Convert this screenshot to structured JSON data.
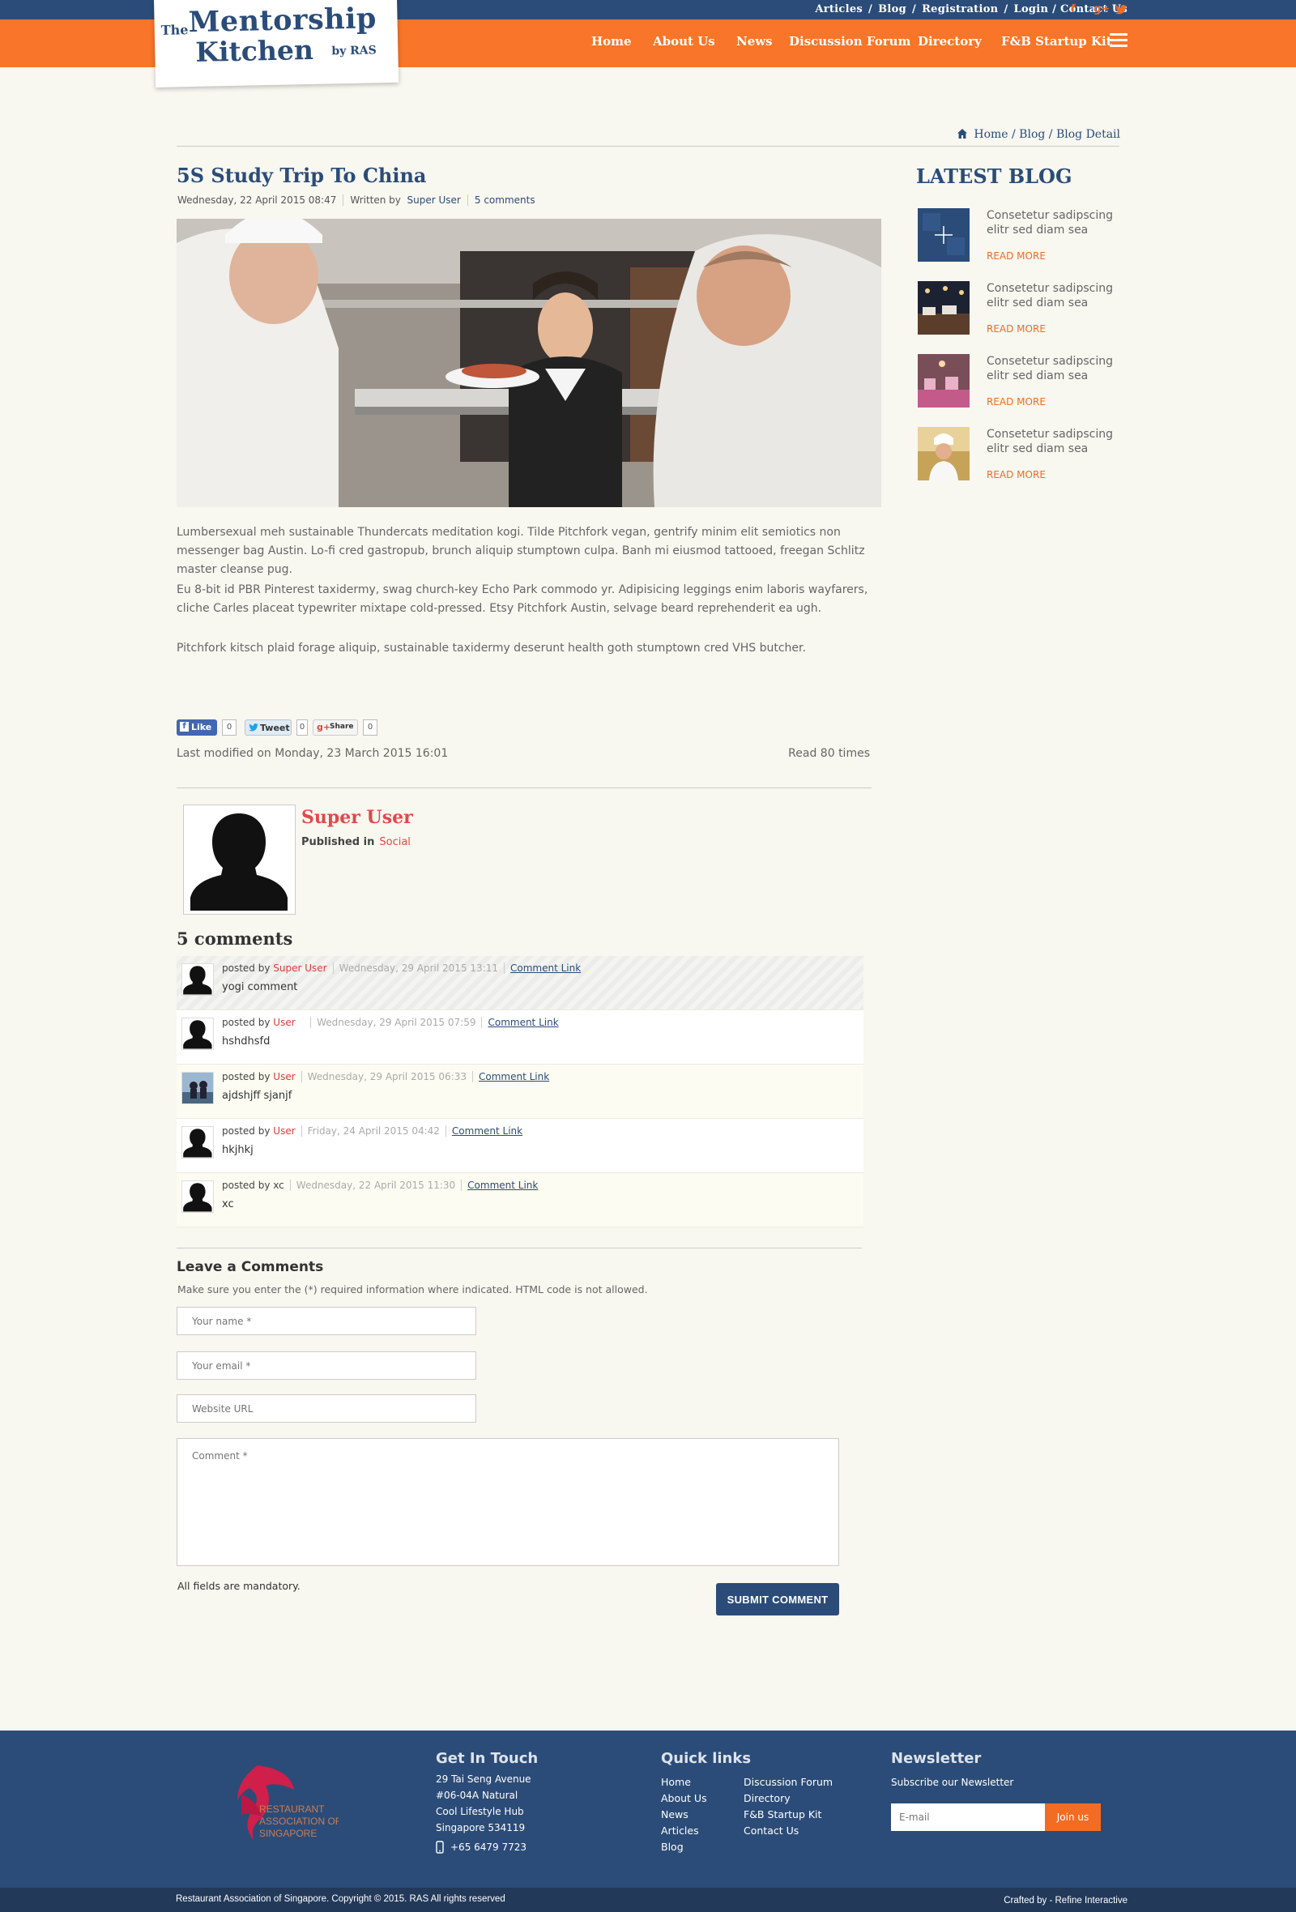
{
  "topbar": {
    "links": [
      "Articles",
      "Blog",
      "Registration",
      "Login / Contact Us"
    ],
    "separator": "/",
    "social": {
      "facebook": "f",
      "googleplus": "g+"
    }
  },
  "logo": {
    "the": "The",
    "line1": "Mentorship",
    "line2": "Kitchen",
    "by": "by RAS"
  },
  "nav": [
    "Home",
    "About Us",
    "News",
    "Discussion Forum",
    "Directory",
    "F&B Startup Kit"
  ],
  "breadcrumb": {
    "home": "Home",
    "rest": "/ Blog / Blog Detail"
  },
  "article": {
    "title": "5S Study Trip To China",
    "date": "Wednesday, 22 April 2015 08:47",
    "written_by": "Written by",
    "author": "Super User",
    "comments_link": "5 comments",
    "paragraphs": [
      "Lumbersexual meh sustainable Thundercats meditation kogi. Tilde Pitchfork vegan, gentrify minim elit semiotics non messenger bag Austin. Lo-fi cred gastropub, brunch aliquip stumptown culpa. Banh mi eiusmod tattooed, freegan Schlitz master cleanse pug.",
      "Eu 8-bit id PBR Pinterest taxidermy, swag church-key Echo Park commodo yr. Adipisicing leggings enim laboris wayfarers, cliche Carles placeat typewriter mixtape cold-pressed. Etsy Pitchfork Austin, selvage beard reprehenderit ea ugh.",
      "Pitchfork kitsch plaid forage aliquip, sustainable taxidermy deserunt health goth stumptown cred VHS butcher."
    ],
    "share": {
      "like": "Like",
      "like_count": "0",
      "tweet": "Tweet",
      "tweet_count": "0",
      "gplus": "Share",
      "gplus_icon": "g+",
      "gplus_count": "0"
    },
    "last_modified": "Last modified on Monday, 23 March 2015 16:01",
    "read_times": "Read 80 times"
  },
  "author_box": {
    "name": "Super User",
    "published_in": "Published in",
    "category": "Social"
  },
  "comments": {
    "title": "5 comments",
    "posted_by": "posted by",
    "link_label": "Comment Link",
    "items": [
      {
        "user": "Super User",
        "date": "Wednesday, 29 April 2015 13:11",
        "text": "yogi comment"
      },
      {
        "user": "User",
        "date": "Wednesday, 29 April 2015 07:59",
        "text": "hshdhsfd"
      },
      {
        "user": "User",
        "date": "Wednesday, 29 April 2015 06:33",
        "text": "ajdshjff sjanjf"
      },
      {
        "user": "User",
        "date": "Friday, 24 April 2015 04:42",
        "text": "hkjhkj"
      },
      {
        "user": "xc",
        "date": "Wednesday, 22 April 2015 11:30",
        "text": "xc"
      }
    ]
  },
  "form": {
    "title": "Leave a Comments",
    "note": "Make sure you enter the (*) required information where indicated. HTML code is not allowed.",
    "name_placeholder": "Your name *",
    "email_placeholder": "Your email *",
    "url_placeholder": "Website URL",
    "comment_placeholder": "Comment *",
    "mandatory": "All fields are mandatory.",
    "submit": "SUBMIT COMMENT"
  },
  "sidebar": {
    "title": "LATEST BLOG",
    "items": [
      {
        "text": "Consetetur sadipscing elitr sed diam sea",
        "more": "READ MORE"
      },
      {
        "text": "Consetetur sadipscing elitr sed diam sea",
        "more": "READ MORE"
      },
      {
        "text": "Consetetur sadipscing elitr sed diam sea",
        "more": "READ MORE"
      },
      {
        "text": "Consetetur sadipscing elitr sed diam sea",
        "more": "READ MORE"
      }
    ]
  },
  "footer": {
    "contact": {
      "title": "Get In Touch",
      "address": [
        "29 Tai Seng Avenue",
        "#06-04A Natural",
        "Cool Lifestyle Hub",
        "Singapore 534119"
      ],
      "phone": "+65 6479 7723"
    },
    "quick": {
      "title": "Quick links",
      "col1": [
        "Home",
        "About Us",
        "News",
        "Articles",
        "Blog"
      ],
      "col2": [
        "Discussion Forum",
        "Directory",
        "F&B Startup Kit",
        "Contact Us"
      ]
    },
    "newsletter": {
      "title": "Newsletter",
      "subtitle": "Subscribe our Newsletter",
      "placeholder": "E-mail",
      "button": "Join us"
    },
    "ras_logo": [
      "RESTAURANT",
      "ASSOCIATION OF",
      "SINGAPORE"
    ],
    "copyright": "Restaurant Association of Singapore. Copyright © 2015. RAS All rights reserved",
    "crafted": "Crafted by - Refine Interactive"
  },
  "colors": {
    "navy": "#2b4c78",
    "orange": "#f87529",
    "accent_red": "#e04a4a",
    "page_bg": "#f8f7f0"
  }
}
